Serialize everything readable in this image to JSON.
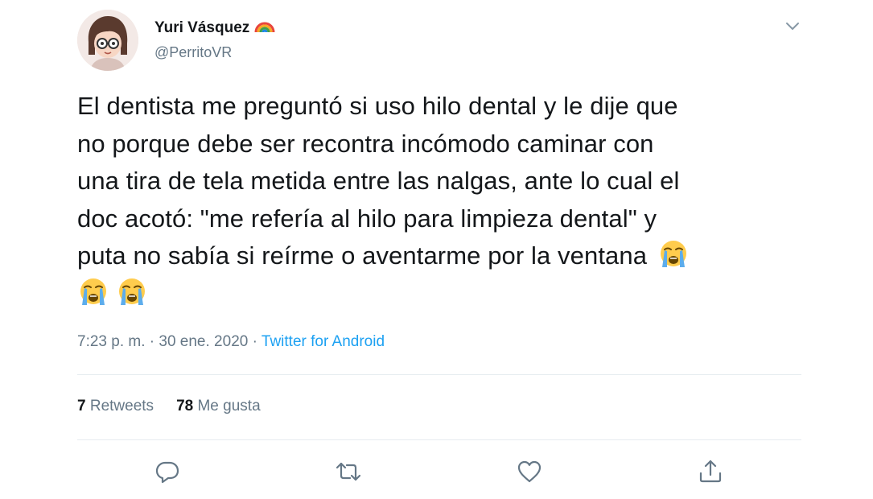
{
  "user": {
    "display_name": "Yuri Vásquez",
    "handle": "@PerritoVR",
    "badge_icon": "rainbow-icon"
  },
  "tweet": {
    "lines": [
      "El dentista me preguntó si uso hilo dental y le dije que",
      "no porque debe ser recontra incómodo caminar con",
      "una tira de tela metida entre las nalgas, ante lo cual el",
      "doc acotó: \"me refería al hilo para limpieza dental\" y",
      "puta no sabía si reírme o aventarme por la ventana"
    ],
    "emoji": "loudly-crying-face-icon"
  },
  "meta": {
    "time": "7:23 p. m.",
    "separator1": " · ",
    "date": "30 ene. 2020",
    "separator2": " · ",
    "source": "Twitter for Android"
  },
  "stats": {
    "retweets_count": "7",
    "retweets_label": "Retweets",
    "likes_count": "78",
    "likes_label": "Me gusta"
  },
  "actions": [
    "reply-icon",
    "retweet-icon",
    "like-icon",
    "share-icon"
  ],
  "colors": {
    "link": "#1da1f2",
    "secondary_text": "#657786",
    "primary_text": "#14171a",
    "divider": "#e6ecf0"
  }
}
